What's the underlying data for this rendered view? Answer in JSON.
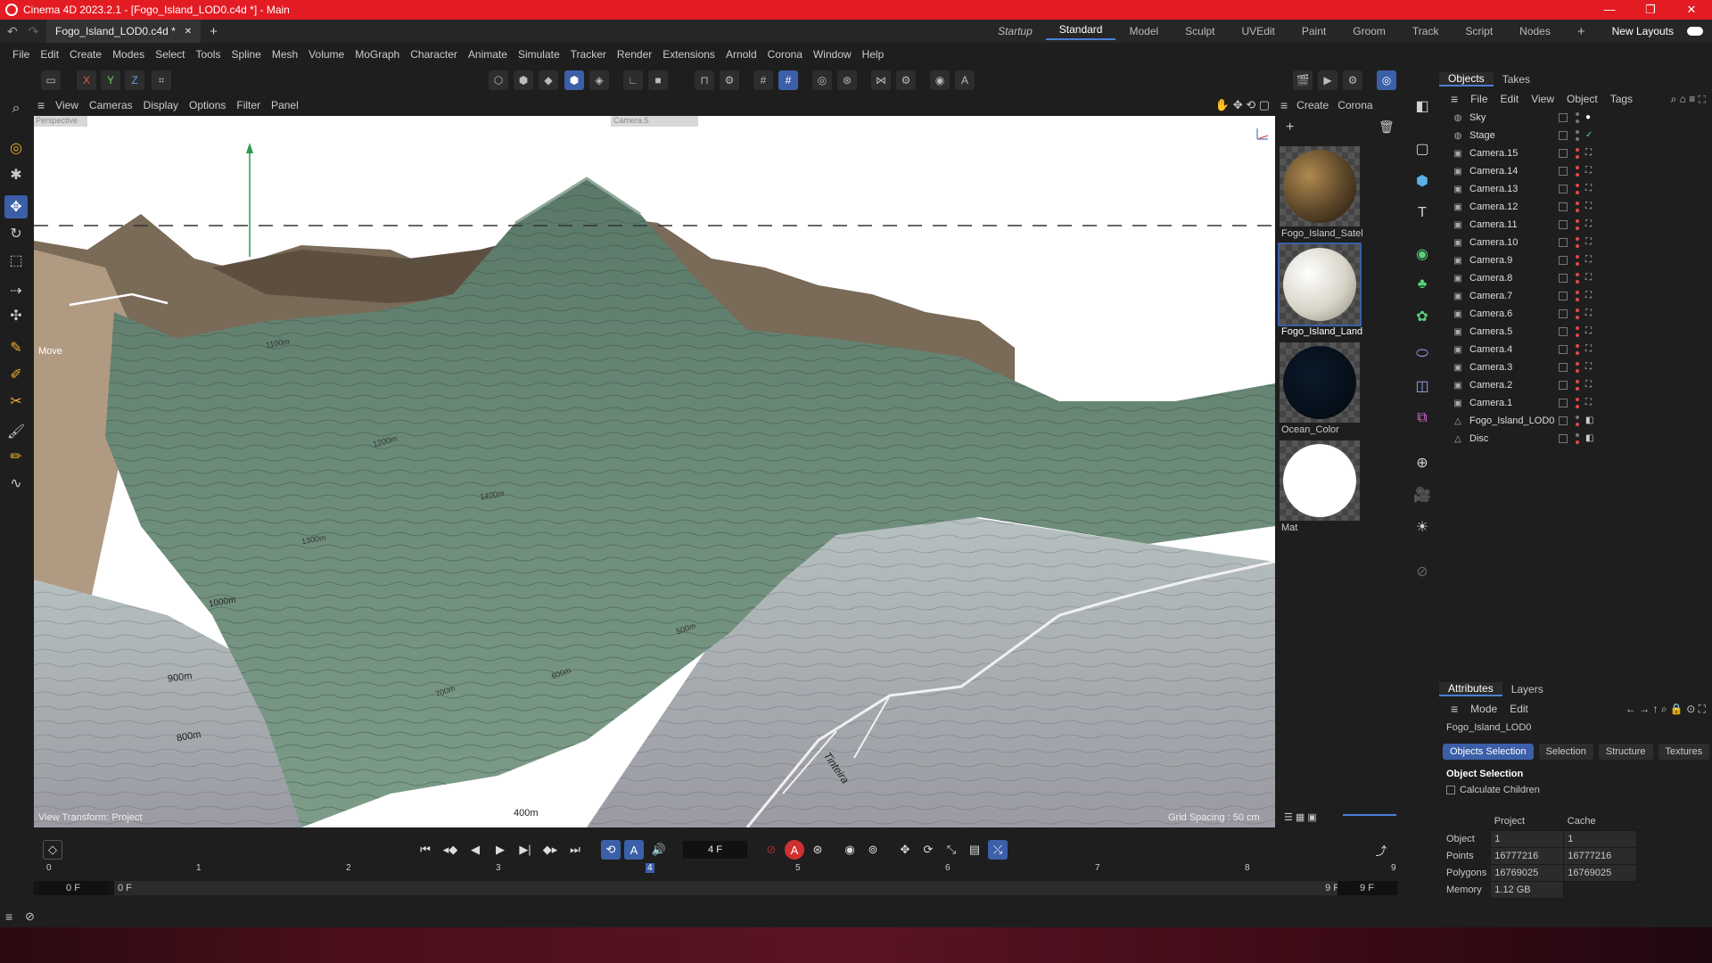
{
  "window": {
    "title": "Cinema 4D 2023.2.1 - [Fogo_Island_LOD0.c4d *] - Main",
    "minimize": "—",
    "maximize": "❐",
    "close": "✕"
  },
  "doc_tab": {
    "label": "Fogo_Island_LOD0.c4d *",
    "close": "✕",
    "add": "+"
  },
  "layouts": {
    "items": [
      "Startup",
      "Standard",
      "Model",
      "Sculpt",
      "UVEdit",
      "Paint",
      "Groom",
      "Track",
      "Script",
      "Nodes"
    ],
    "add": "+",
    "new_layouts": "New Layouts"
  },
  "menubar": [
    "File",
    "Edit",
    "Create",
    "Modes",
    "Select",
    "Tools",
    "Spline",
    "Mesh",
    "Volume",
    "MoGraph",
    "Character",
    "Animate",
    "Simulate",
    "Tracker",
    "Render",
    "Extensions",
    "Arnold",
    "Corona",
    "Window",
    "Help"
  ],
  "toolbar": {
    "axis_x": "X",
    "axis_y": "Y",
    "axis_z": "Z"
  },
  "viewport": {
    "menu": [
      "View",
      "Cameras",
      "Display",
      "Options",
      "Filter",
      "Panel"
    ],
    "camera_label": "Perspective",
    "camera_select": "Camera.5",
    "hud_move": "Move",
    "view_transform": "View Transform: Project",
    "grid_spacing": "Grid Spacing : 50 cm",
    "terrain_labels": [
      "1400m",
      "1300m",
      "1200m",
      "1000m",
      "900m",
      "800m",
      "700m",
      "600m",
      "500m",
      "400m",
      "Tinteira",
      "1100m"
    ]
  },
  "materials": {
    "menu": [
      "Create",
      "Corona"
    ],
    "items": [
      {
        "label": "Fogo_Island_Satel"
      },
      {
        "label": "Fogo_Island_Land"
      },
      {
        "label": "Ocean_Color"
      },
      {
        "label": "Mat"
      }
    ]
  },
  "objects_panel": {
    "tabs": [
      "Objects",
      "Takes"
    ],
    "menu": [
      "File",
      "Edit",
      "View",
      "Object",
      "Tags"
    ],
    "items": [
      "Sky",
      "Stage",
      "Camera.15",
      "Camera.14",
      "Camera.13",
      "Camera.12",
      "Camera.11",
      "Camera.10",
      "Camera.9",
      "Camera.8",
      "Camera.7",
      "Camera.6",
      "Camera.5",
      "Camera.4",
      "Camera.3",
      "Camera.2",
      "Camera.1",
      "Fogo_Island_LOD0",
      "Disc"
    ]
  },
  "attributes": {
    "tabs": [
      "Attributes",
      "Layers"
    ],
    "menu": [
      "Mode",
      "Edit"
    ],
    "object_name": "Fogo_Island_LOD0",
    "sub_tabs": [
      "Objects Selection",
      "Selection",
      "Structure",
      "Textures"
    ],
    "section": "Object Selection",
    "calc_children": "Calculate Children",
    "col_project": "Project",
    "col_cache": "Cache",
    "rows": [
      {
        "label": "Object",
        "project": "1",
        "cache": "1"
      },
      {
        "label": "Points",
        "project": "16777216",
        "cache": "16777216"
      },
      {
        "label": "Polygons",
        "project": "16769025",
        "cache": "16769025"
      },
      {
        "label": "Memory",
        "project": "1.12 GB",
        "cache": ""
      }
    ]
  },
  "timeline": {
    "current_frame": "4 F",
    "ticks": [
      "0",
      "1",
      "2",
      "3",
      "4",
      "5",
      "6",
      "7",
      "8",
      "9"
    ],
    "start_field": "0 F",
    "range_start": "0 F",
    "range_end": "9 F",
    "end_field": "9 F"
  }
}
